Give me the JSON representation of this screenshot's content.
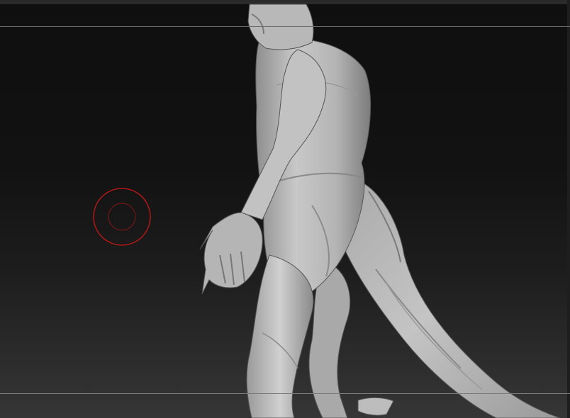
{
  "app": {
    "name": "",
    "mode": "sculpt-viewport"
  },
  "canvas": {
    "background_top": "#0f0f0f",
    "background_bottom": "#363636",
    "frame_line_color": "#6b6b6b"
  },
  "brush": {
    "icon": "brush-cursor-icon",
    "outer_color": "#b01818",
    "inner_color": "#8a1515"
  },
  "model": {
    "icon": "creature-sculpt",
    "color": "#bdbdbd"
  }
}
